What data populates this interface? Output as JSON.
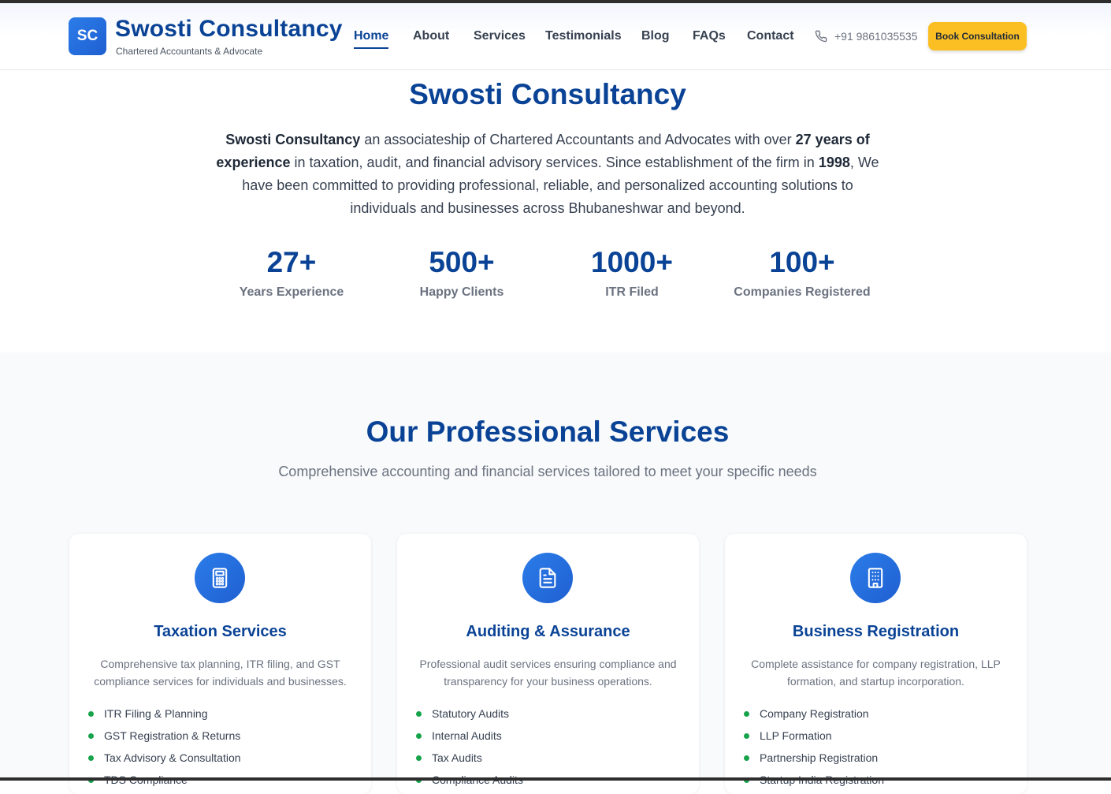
{
  "header": {
    "logo_initials": "SC",
    "brand_title": "Swosti Consultancy",
    "brand_subtitle": "Chartered Accountants & Advocate",
    "nav": [
      "Home",
      "About",
      "Services",
      "Testimonials",
      "Blog",
      "FAQs",
      "Contact"
    ],
    "active_nav": "Home",
    "phone": "+91 9861035535",
    "cta_label": "Book Consultation"
  },
  "hero": {
    "title": "Swosti Consultancy",
    "intro": {
      "firm": "Swosti Consultancy",
      "t1": " an associateship of Chartered Accountants and Advocates with over ",
      "years": "27 years of experience",
      "t2": " in taxation, audit, and financial advisory services. Since establishment of the firm in ",
      "year": "1998",
      "t3": ", We have been committed to providing professional, reliable, and personalized accounting solutions to individuals and businesses across Bhubaneshwar and beyond."
    },
    "stats": [
      {
        "value": "27+",
        "label": "Years Experience"
      },
      {
        "value": "500+",
        "label": "Happy Clients"
      },
      {
        "value": "1000+",
        "label": "ITR Filed"
      },
      {
        "value": "100+",
        "label": "Companies Registered"
      }
    ]
  },
  "services": {
    "title": "Our Professional Services",
    "subtitle": "Comprehensive accounting and financial services tailored to meet your specific needs",
    "cards": [
      {
        "icon": "calculator-icon",
        "title": "Taxation Services",
        "description": "Comprehensive tax planning, ITR filing, and GST compliance services for individuals and businesses.",
        "items": [
          "ITR Filing & Planning",
          "GST Registration & Returns",
          "Tax Advisory & Consultation",
          "TDS Compliance"
        ]
      },
      {
        "icon": "document-icon",
        "title": "Auditing & Assurance",
        "description": "Professional audit services ensuring compliance and transparency for your business operations.",
        "items": [
          "Statutory Audits",
          "Internal Audits",
          "Tax Audits",
          "Compliance Audits"
        ]
      },
      {
        "icon": "building-icon",
        "title": "Business Registration",
        "description": "Complete assistance for company registration, LLP formation, and startup incorporation.",
        "items": [
          "Company Registration",
          "LLP Formation",
          "Partnership Registration",
          "Startup India Registration"
        ]
      }
    ]
  },
  "colors": {
    "brand": "#0a4396",
    "accent_blue": "#1f5fd1",
    "cta": "#fbbf24",
    "bullet": "#16a34a"
  }
}
